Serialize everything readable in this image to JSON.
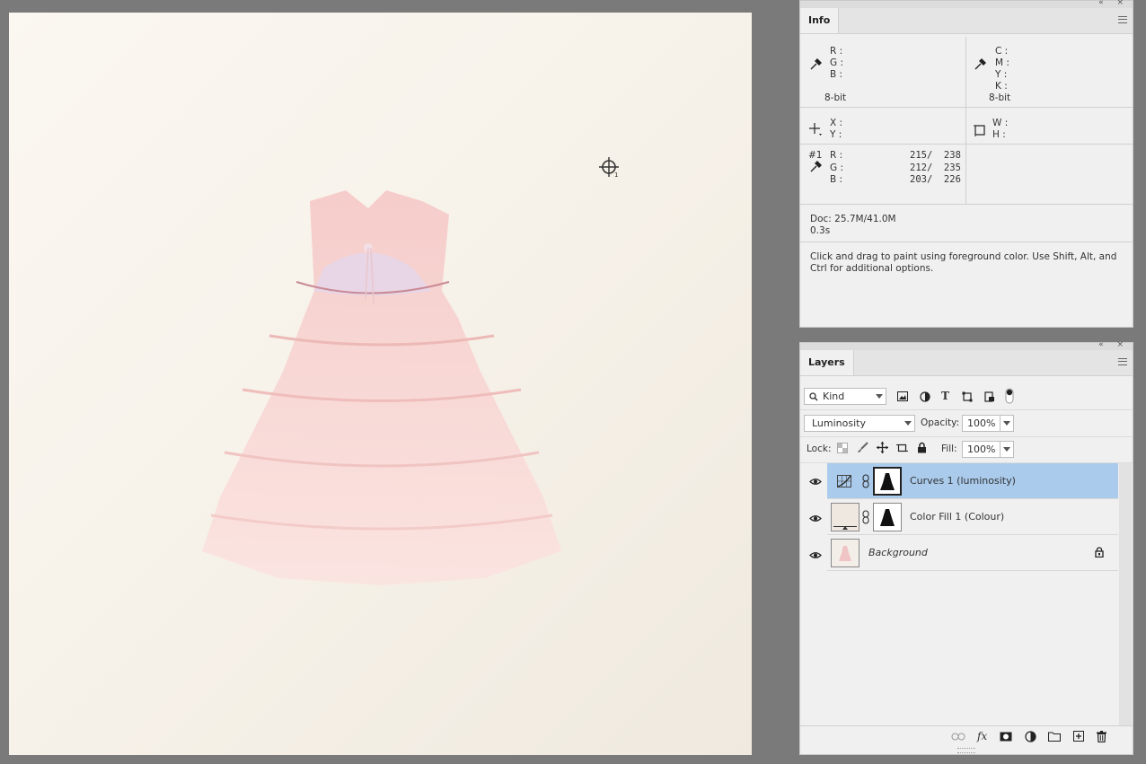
{
  "info": {
    "tab_label": "Info",
    "rgb": {
      "labels": [
        "R :",
        "G :",
        "B :"
      ],
      "bit": "8-bit"
    },
    "cmyk": {
      "labels": [
        "C :",
        "M :",
        "Y :",
        "K :"
      ],
      "bit": "8-bit"
    },
    "xy": {
      "labels": [
        "X :",
        "Y :"
      ]
    },
    "wh": {
      "labels": [
        "W :",
        "H :"
      ]
    },
    "sampler": {
      "id": "#1",
      "labels": [
        "R :",
        "G :",
        "B :"
      ],
      "values": [
        "215/  238",
        "212/  235",
        "203/  226"
      ]
    },
    "doc": "Doc: 25.7M/41.0M",
    "time": "0.3s",
    "hint_line1": "Click and drag to paint using foreground color.  Use Shift, Alt, and",
    "hint_line2": "Ctrl for additional options."
  },
  "layers": {
    "tab_label": "Layers",
    "filter_kind": "Kind",
    "blend_mode": "Luminosity",
    "opacity_label": "Opacity:",
    "opacity_value": "100%",
    "lock_label": "Lock:",
    "fill_label": "Fill:",
    "fill_value": "100%",
    "items": [
      {
        "name": "Curves 1 (luminosity)",
        "selected": true
      },
      {
        "name": "Color Fill 1 (Colour)",
        "selected": false
      },
      {
        "name": "Background",
        "selected": false
      }
    ]
  },
  "colors": {
    "selection": "#aacbec",
    "panel_bg": "#f0f0f0",
    "workspace": "#7a7a7a",
    "dress_pink": "#f4cfcc"
  }
}
